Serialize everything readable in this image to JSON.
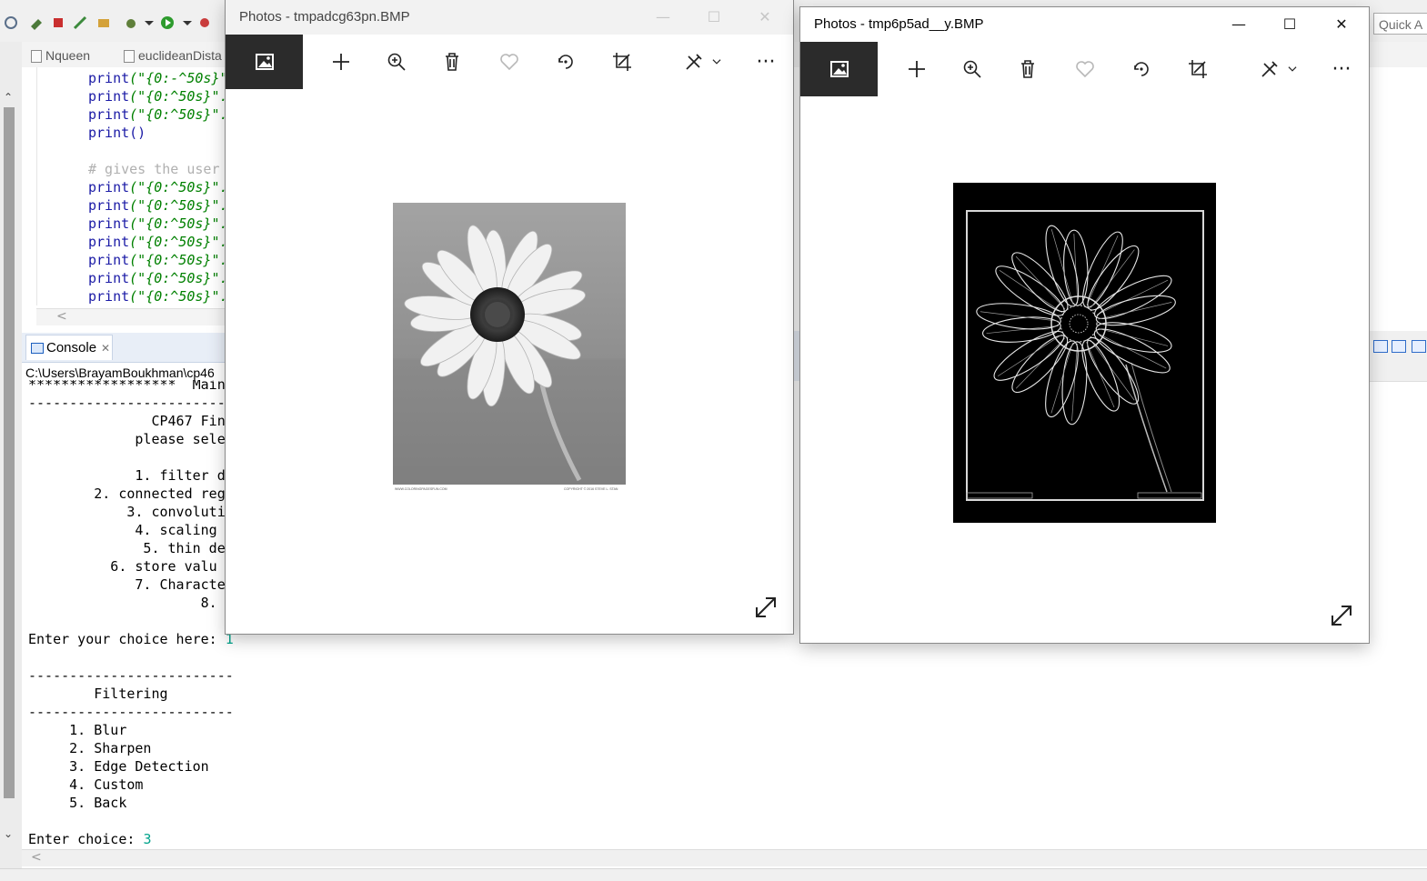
{
  "ide": {
    "quick_access": "Quick A",
    "editor_tabs": [
      "Nqueen",
      "euclideanDista"
    ],
    "code_lines": [
      {
        "fn": "print",
        "args": "(\"{0:-^50s}\"",
        "kind": "str"
      },
      {
        "fn": "print",
        "args": "(\"{0:^50s}\".",
        "kind": "str"
      },
      {
        "fn": "print",
        "args": "(\"{0:^50s}\".",
        "kind": "str"
      },
      {
        "fn": "print",
        "args": "()",
        "kind": "plain"
      },
      {
        "fn": "",
        "args": "",
        "kind": "blank"
      },
      {
        "fn": "# gives the user",
        "args": "",
        "kind": "comment"
      },
      {
        "fn": "print",
        "args": "(\"{0:^50s}\".",
        "kind": "str"
      },
      {
        "fn": "print",
        "args": "(\"{0:^50s}\".",
        "kind": "str"
      },
      {
        "fn": "print",
        "args": "(\"{0:^50s}\".",
        "kind": "str"
      },
      {
        "fn": "print",
        "args": "(\"{0:^50s}\".",
        "kind": "str"
      },
      {
        "fn": "print",
        "args": "(\"{0:^50s}\".",
        "kind": "str"
      },
      {
        "fn": "print",
        "args": "(\"{0:^50s}\".",
        "kind": "str"
      },
      {
        "fn": "print",
        "args": "(\"{0:^50s}\".",
        "kind": "str"
      }
    ],
    "console_tab_label": "Console",
    "console_path": "C:\\Users\\BrayamBoukhman\\cp46",
    "console_lines": [
      "******************  Main",
      "-------------------------",
      "               CP467 Fin",
      "             please sele",
      "",
      "             1. filter d",
      "        2. connected reg",
      "            3. convoluti",
      "             4. scaling ",
      "              5. thin de",
      "          6. store valu",
      "             7. Characte",
      "                     8. ",
      "",
      "Enter your choice here: ",
      "",
      "-------------------------",
      "        Filtering",
      "-------------------------",
      "     1. Blur",
      "     2. Sharpen",
      "     3. Edge Detection",
      "     4. Custom",
      "     5. Back",
      "",
      "Enter choice: "
    ],
    "choice_main": "1",
    "choice_filter": "3"
  },
  "photos_left": {
    "title": "Photos - tmpadcg63pn.BMP",
    "image_footer_left": "WWW.COLORINGPAGESFUN.COM",
    "image_footer_right": "COPYRIGHT © 2016 STEVE L. STAN"
  },
  "photos_right": {
    "title": "Photos - tmp6p5ad__y.BMP"
  },
  "window_controls": {
    "minimize": "—",
    "maximize": "☐",
    "close": "✕"
  },
  "toolbar_icons": [
    "image-view-icon",
    "add-icon",
    "zoom-icon",
    "delete-icon",
    "favorite-icon",
    "rotate-icon",
    "crop-icon",
    "edit-create-icon",
    "more-icon"
  ],
  "more_label": "···",
  "colors": {
    "active_tab": "#2b2b2b",
    "console_input": "#00a38b",
    "code_string": "#2a00ff",
    "code_keyword": "#1a1aa6"
  }
}
